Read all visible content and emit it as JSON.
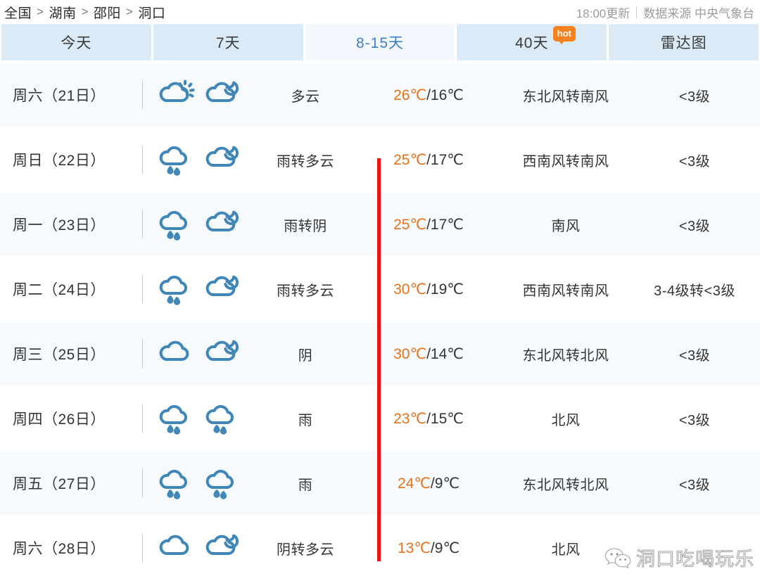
{
  "header": {
    "breadcrumb": [
      "全国",
      "湖南",
      "邵阳",
      "洞口"
    ],
    "separator": ">",
    "update_time": "18:00更新",
    "source": "数据来源 中央气象台"
  },
  "tabs": [
    {
      "label": "今天",
      "active": false,
      "badge": null
    },
    {
      "label": "7天",
      "active": false,
      "badge": null
    },
    {
      "label": "8-15天",
      "active": true,
      "badge": null
    },
    {
      "label": "40天",
      "active": false,
      "badge": "hot"
    },
    {
      "label": "雷达图",
      "active": false,
      "badge": null
    }
  ],
  "forecast": [
    {
      "day": "周六（21日）",
      "icon_day": "cloudy-day-icon",
      "icon_night": "cloudy-night-icon",
      "desc": "多云",
      "temp_high": "26℃",
      "temp_sep": "/",
      "temp_low": "16℃",
      "wind": "东北风转南风",
      "level": "<3级"
    },
    {
      "day": "周日（22日）",
      "icon_day": "rain-day-icon",
      "icon_night": "cloudy-night-icon",
      "desc": "雨转多云",
      "temp_high": "25℃",
      "temp_sep": "/",
      "temp_low": "17℃",
      "wind": "西南风转南风",
      "level": "<3级"
    },
    {
      "day": "周一（23日）",
      "icon_day": "rain-day-icon",
      "icon_night": "cloudy-night-icon",
      "desc": "雨转阴",
      "temp_high": "25℃",
      "temp_sep": "/",
      "temp_low": "17℃",
      "wind": "南风",
      "level": "<3级"
    },
    {
      "day": "周二（24日）",
      "icon_day": "rain-day-icon",
      "icon_night": "cloudy-night-icon",
      "desc": "雨转多云",
      "temp_high": "30℃",
      "temp_sep": "/",
      "temp_low": "19℃",
      "wind": "西南风转南风",
      "level": "3-4级转<3级"
    },
    {
      "day": "周三（25日）",
      "icon_day": "overcast-icon",
      "icon_night": "cloudy-night-icon",
      "desc": "阴",
      "temp_high": "30℃",
      "temp_sep": "/",
      "temp_low": "14℃",
      "wind": "东北风转北风",
      "level": "<3级"
    },
    {
      "day": "周四（26日）",
      "icon_day": "rain-day-icon",
      "icon_night": "rain-night-icon",
      "desc": "雨",
      "temp_high": "23℃",
      "temp_sep": "/",
      "temp_low": "15℃",
      "wind": "北风",
      "level": "<3级"
    },
    {
      "day": "周五（27日）",
      "icon_day": "rain-day-icon",
      "icon_night": "rain-night-icon",
      "desc": "雨",
      "temp_high": "24℃",
      "temp_sep": "/",
      "temp_low": "9℃",
      "wind": "东北风转北风",
      "level": "<3级"
    },
    {
      "day": "周六（28日）",
      "icon_day": "overcast-icon",
      "icon_night": "cloudy-night-icon",
      "desc": "阴转多云",
      "temp_high": "13℃",
      "temp_sep": "/",
      "temp_low": "9℃",
      "wind": "北风",
      "level": ""
    }
  ],
  "annotation": {
    "red_line_color": "#ee1111"
  },
  "watermark": {
    "logo": "wechat-logo-icon",
    "text": "洞口吃喝玩乐"
  },
  "colors": {
    "tab_active_bg": "#f2f8fe",
    "tab_active_text": "#3f7fc8",
    "tab_bg": "#dbeaf7",
    "high_temp": "#e8701a",
    "icon_blue": "#3f87b8",
    "badge_orange": "#f5821f",
    "row_alt_bg": "#f7fafd"
  }
}
